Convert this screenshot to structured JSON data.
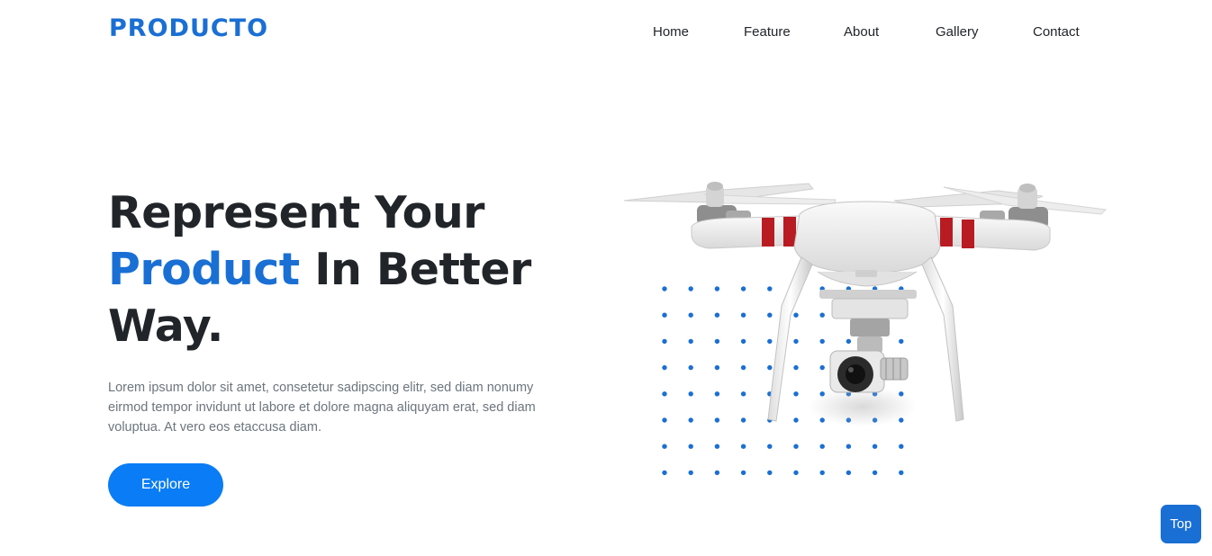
{
  "brand": {
    "logo": "PRODUCTO",
    "accent_color": "#1a6fd4"
  },
  "nav": {
    "items": [
      {
        "label": "Home"
      },
      {
        "label": "Feature"
      },
      {
        "label": "About"
      },
      {
        "label": "Gallery"
      },
      {
        "label": "Contact"
      }
    ]
  },
  "hero": {
    "title_line1": "Represent Your",
    "title_accent": "Product",
    "title_line2_rest": " In Better",
    "title_line3": "Way.",
    "description": "Lorem ipsum dolor sit amet, consetetur sadipscing elitr, sed diam nonumy eirmod tempor invidunt ut labore et dolore magna aliquyam erat, sed diam voluptua. At vero eos etaccusa diam.",
    "cta_label": "Explore",
    "image": "drone-product-image",
    "decoration": "dot-grid-pattern"
  },
  "back_to_top": {
    "label": "Top"
  }
}
